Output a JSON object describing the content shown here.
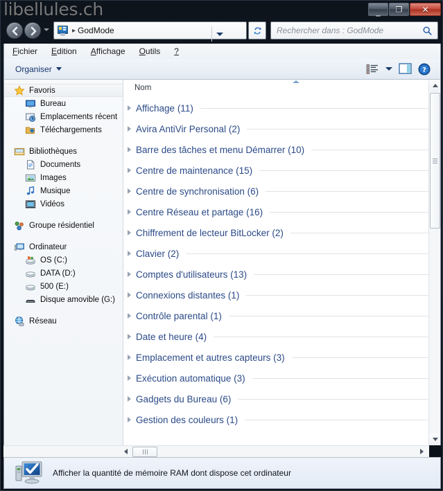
{
  "window": {
    "watermark": "libellules.ch",
    "buttons": {
      "minimize": "—",
      "maximize": "❐",
      "close": "✕"
    }
  },
  "addressbar": {
    "icon": "control-panel-icon",
    "separator": "▸",
    "path": "GodMode",
    "dropdown_icon": "chevron-down-icon",
    "refresh_icon": "refresh-icon",
    "back_icon": "back-arrow-icon",
    "forward_icon": "forward-arrow-icon",
    "history_icon": "history-chevron-icon"
  },
  "search": {
    "placeholder": "Rechercher dans : GodMode",
    "icon": "magnifier-icon"
  },
  "menubar": {
    "items": [
      {
        "accel": "F",
        "rest": "ichier"
      },
      {
        "accel": "E",
        "rest": "dition"
      },
      {
        "accel": "A",
        "rest": "ffichage"
      },
      {
        "accel": "O",
        "rest": "utils"
      },
      {
        "accel": "?",
        "rest": ""
      }
    ]
  },
  "toolbar": {
    "organise_label": "Organiser",
    "views_icon": "views-list-icon",
    "views_chevron_icon": "chevron-down-icon",
    "preview_pane_icon": "preview-pane-icon",
    "help_icon": "help-icon"
  },
  "sidebar": {
    "groups": [
      {
        "header": {
          "label": "Favoris",
          "icon": "star-icon",
          "selected": true
        },
        "items": [
          {
            "label": "Bureau",
            "icon": "desktop-icon"
          },
          {
            "label": "Emplacements récent",
            "icon": "recent-places-icon"
          },
          {
            "label": "Téléchargements",
            "icon": "downloads-icon"
          }
        ]
      },
      {
        "header": {
          "label": "Bibliothèques",
          "icon": "libraries-icon",
          "selected": false
        },
        "items": [
          {
            "label": "Documents",
            "icon": "documents-icon"
          },
          {
            "label": "Images",
            "icon": "pictures-icon"
          },
          {
            "label": "Musique",
            "icon": "music-icon"
          },
          {
            "label": "Vidéos",
            "icon": "videos-icon"
          }
        ]
      },
      {
        "header": {
          "label": "Groupe résidentiel",
          "icon": "homegroup-icon",
          "selected": false
        },
        "items": []
      },
      {
        "header": {
          "label": "Ordinateur",
          "icon": "computer-icon",
          "selected": false
        },
        "items": [
          {
            "label": "OS (C:)",
            "icon": "system-drive-icon"
          },
          {
            "label": "DATA (D:)",
            "icon": "drive-icon"
          },
          {
            "label": "500 (E:)",
            "icon": "drive-icon"
          },
          {
            "label": "Disque amovible (G:)",
            "icon": "removable-drive-icon"
          }
        ]
      },
      {
        "header": {
          "label": "Réseau",
          "icon": "network-icon",
          "selected": false
        },
        "items": []
      }
    ]
  },
  "list": {
    "column_header": "Nom",
    "sort_indicator": "ascending",
    "groups": [
      {
        "name": "Affichage",
        "count": "(11)"
      },
      {
        "name": "Avira AntiVir Personal",
        "count": "(2)"
      },
      {
        "name": "Barre des tâches et menu Démarrer",
        "count": "(10)"
      },
      {
        "name": "Centre de maintenance",
        "count": "(15)"
      },
      {
        "name": "Centre de synchronisation",
        "count": "(6)"
      },
      {
        "name": "Centre Réseau et partage",
        "count": "(16)"
      },
      {
        "name": "Chiffrement de lecteur BitLocker",
        "count": "(2)"
      },
      {
        "name": "Clavier",
        "count": "(2)"
      },
      {
        "name": "Comptes d'utilisateurs",
        "count": "(13)"
      },
      {
        "name": "Connexions distantes",
        "count": "(1)"
      },
      {
        "name": "Contrôle parental",
        "count": "(1)"
      },
      {
        "name": "Date et heure",
        "count": "(4)"
      },
      {
        "name": "Emplacement et autres capteurs",
        "count": "(3)"
      },
      {
        "name": "Exécution automatique",
        "count": "(3)"
      },
      {
        "name": "Gadgets du Bureau",
        "count": "(6)"
      },
      {
        "name": "Gestion des couleurs",
        "count": "(1)"
      }
    ]
  },
  "statusbar": {
    "icon": "computer-check-icon",
    "text": "Afficher la quantité de mémoire RAM dont dispose cet ordinateur"
  },
  "colors": {
    "group_name": "#2b4a87",
    "accent": "#15366b",
    "titlebar": "#0d141c",
    "close_button": "#c2493a"
  }
}
